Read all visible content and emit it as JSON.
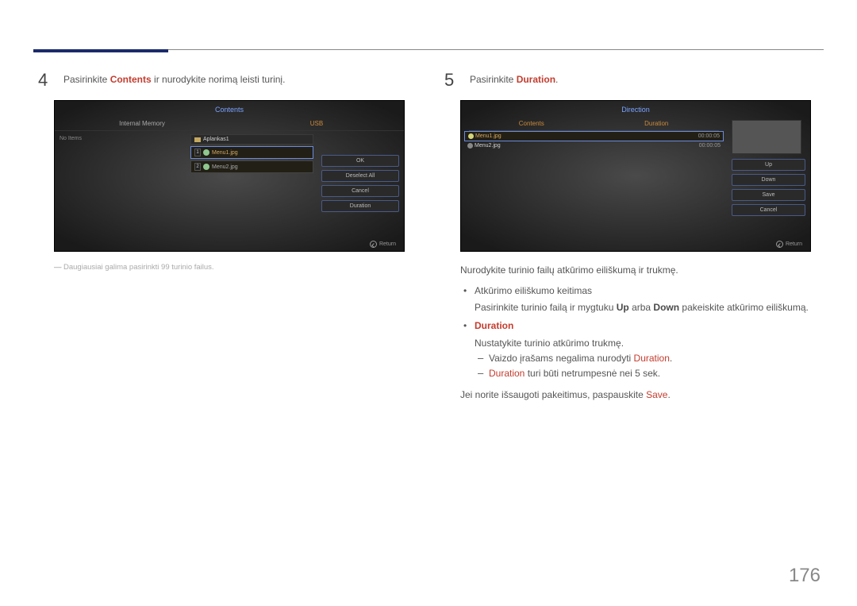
{
  "page_number": "176",
  "step4": {
    "number": "4",
    "prefix": "Pasirinkite ",
    "highlight": "Contents",
    "suffix": " ir nurodykite norimą leisti turinį.",
    "note": "Daugiausiai galima pasirinkti 99 turinio failus.",
    "screen": {
      "title": "Contents",
      "tabs": {
        "left": "Internal Memory",
        "right": "USB"
      },
      "no_items": "No Items",
      "folder": "Aplankas1",
      "file1": "Menu1.jpg",
      "file2": "Menu2.jpg",
      "index1": "1",
      "index2": "2",
      "buttons": {
        "ok": "OK",
        "deselect": "Deselect All",
        "cancel": "Cancel",
        "duration": "Duration"
      },
      "return": "Return"
    }
  },
  "step5": {
    "number": "5",
    "prefix": "Pasirinkite ",
    "highlight": "Duration",
    "suffix": ".",
    "screen": {
      "title": "Direction",
      "tabs": {
        "left": "Contents",
        "right": "Duration"
      },
      "file1": "Menu1.jpg",
      "file2": "Menu2.jpg",
      "dur1": "00:00:05",
      "dur2": "00:00:05",
      "buttons": {
        "up": "Up",
        "down": "Down",
        "save": "Save",
        "cancel": "Cancel"
      },
      "return": "Return"
    },
    "text": {
      "line1": "Nurodykite turinio failų atkūrimo eiliškumą ir trukmę.",
      "bullet1_title": "Atkūrimo eiliškumo keitimas",
      "bullet1_line_a": "Pasirinkite turinio failą ir mygtuku ",
      "bullet1_up": "Up",
      "bullet1_mid": " arba ",
      "bullet1_down": "Down",
      "bullet1_line_b": " pakeiskite atkūrimo eiliškumą.",
      "bullet2_title": "Duration",
      "bullet2_line": "Nustatykite turinio atkūrimo trukmę.",
      "dash1_a": "Vaizdo įrašams negalima nurodyti ",
      "dash1_b": "Duration",
      "dash1_c": ".",
      "dash2_a": "Duration",
      "dash2_b": " turi būti netrumpesnė nei 5 sek.",
      "line2_a": "Jei norite išsaugoti pakeitimus, paspauskite ",
      "line2_b": "Save",
      "line2_c": "."
    }
  }
}
